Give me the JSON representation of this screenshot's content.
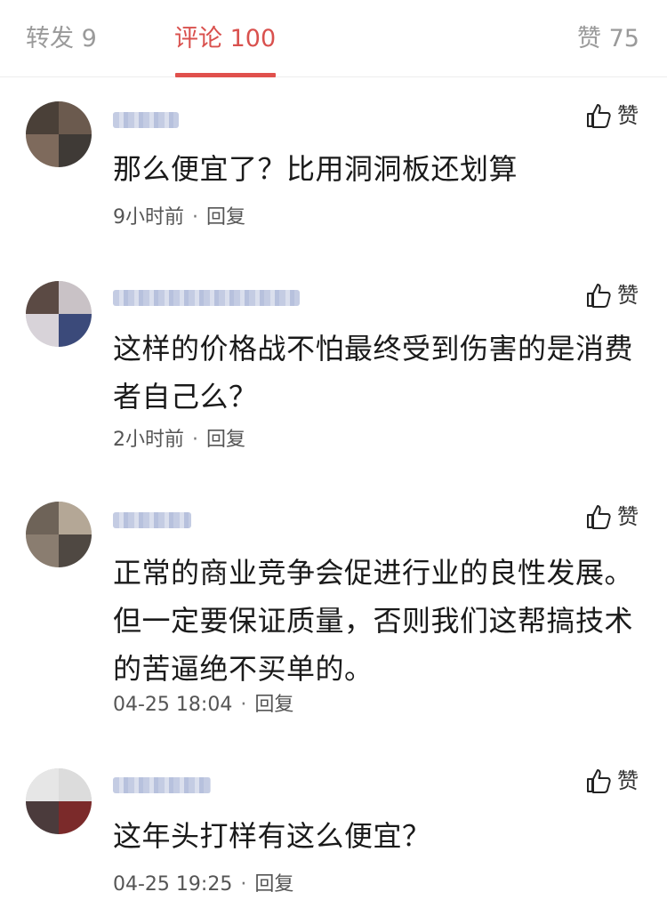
{
  "tabs": {
    "repost": "转发 9",
    "comments": "评论 100",
    "likes": "赞 75"
  },
  "colors": {
    "accent": "#e0504c",
    "muted": "#9a9a9a",
    "username_blur": "#b9c3de"
  },
  "comments": [
    {
      "text": "那么便宜了？比用洞洞板还划算",
      "time": "9小时前",
      "reply_label": "回复",
      "like_label": "赞",
      "like_icon": "thumbs-up-icon"
    },
    {
      "text": "这样的价格战不怕最终受到伤害的是消费者自己么？",
      "time": "2小时前",
      "reply_label": "回复",
      "like_label": "赞",
      "like_icon": "thumbs-up-icon"
    },
    {
      "text": "正常的商业竞争会促进行业的良性发展。但一定要保证质量，否则我们这帮搞技术的苦逼绝不买单的。",
      "time": "04-25 18:04",
      "reply_label": "回复",
      "like_label": "赞",
      "like_icon": "thumbs-up-icon"
    },
    {
      "text": "这年头打样有这么便宜？",
      "time": "04-25 19:25",
      "reply_label": "回复",
      "like_label": "赞",
      "like_icon": "thumbs-up-icon"
    }
  ]
}
